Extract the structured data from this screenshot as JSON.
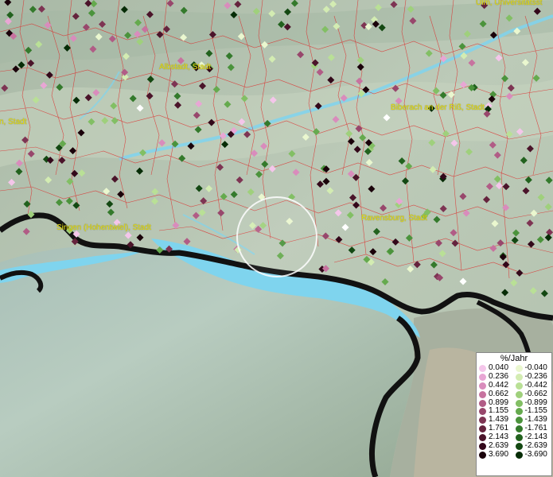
{
  "map": {
    "places": [
      {
        "name": "Ulm, Universitätsst",
        "role": "place"
      },
      {
        "name": "Albstadt, Stadt",
        "role": "place"
      },
      {
        "name": "Biberach an der Riß, Stadt",
        "role": "place"
      },
      {
        "name": "n, Stadt",
        "role": "place"
      },
      {
        "name": "Singen (Hohentwiel), Stadt",
        "role": "place"
      },
      {
        "name": "Ravensburg, Stadt",
        "role": "place"
      }
    ],
    "colors": {
      "terrain": "#b6c4b2",
      "lake": "#7fd4ee",
      "boundary_red": "#e02020",
      "border_black": "#111111",
      "label": "#e8e010"
    }
  },
  "legend": {
    "title": "%/Jahr",
    "positive": [
      {
        "value": "0.040",
        "color": "#f4c6ea"
      },
      {
        "value": "0.236",
        "color": "#e8a6d4"
      },
      {
        "value": "0.442",
        "color": "#d98cbc"
      },
      {
        "value": "0.662",
        "color": "#c7739f"
      },
      {
        "value": "0.899",
        "color": "#b15c86"
      },
      {
        "value": "1.155",
        "color": "#98476c"
      },
      {
        "value": "1.439",
        "color": "#7e3453"
      },
      {
        "value": "1.761",
        "color": "#65233d"
      },
      {
        "value": "2.143",
        "color": "#4b142a"
      },
      {
        "value": "2.639",
        "color": "#33081a"
      },
      {
        "value": "3.690",
        "color": "#1a020a"
      }
    ],
    "negative": [
      {
        "value": "-0.040",
        "color": "#eaf7cf"
      },
      {
        "value": "-0.236",
        "color": "#d3ecb2"
      },
      {
        "value": "-0.442",
        "color": "#b9e096"
      },
      {
        "value": "-0.662",
        "color": "#9fd07c"
      },
      {
        "value": "-0.899",
        "color": "#82bf64"
      },
      {
        "value": "-1.155",
        "color": "#65aa4e"
      },
      {
        "value": "-1.439",
        "color": "#4b933c"
      },
      {
        "value": "-1.761",
        "color": "#347a2c"
      },
      {
        "value": "-2.143",
        "color": "#22621e"
      },
      {
        "value": "-2.639",
        "color": "#134812"
      },
      {
        "value": "-3.690",
        "color": "#062c06"
      }
    ]
  }
}
